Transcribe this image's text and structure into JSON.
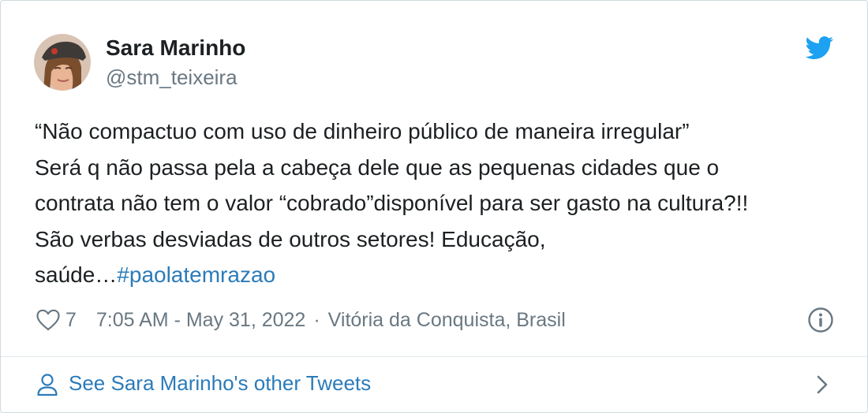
{
  "author": {
    "name": "Sara Marinho",
    "handle": "@stm_teixeira",
    "avatar": "avatar-photo"
  },
  "brand_icon": "twitter-bird-icon",
  "brand_color": "#1da1f2",
  "link_color": "#2b7bb9",
  "tweet": {
    "lines": [
      "“Não compactuo com uso de dinheiro público de maneira irregular”",
      "Será q não passa pela a cabeça dele que as pequenas cidades que o",
      "contrata não tem o valor “cobrado”disponível para ser gasto na cultura?!!",
      "São verbas desviadas de outros setores! Educação,"
    ],
    "last_line_text": "saúde…",
    "hashtag": "#paolatemrazao"
  },
  "meta": {
    "like_icon": "heart-icon",
    "likes": "7",
    "timestamp": "7:05 AM - May 31, 2022",
    "separator": "·",
    "location": "Vitória da Conquista, Brasil",
    "info_icon": "info-icon"
  },
  "footer": {
    "icon": "person-icon",
    "label": "See Sara Marinho's other Tweets",
    "chevron": "chevron-right-icon"
  }
}
